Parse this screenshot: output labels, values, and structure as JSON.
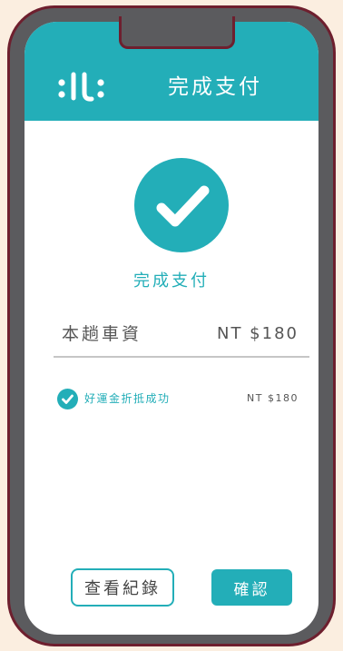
{
  "header": {
    "logo_icon": "brand-logo-icon",
    "title": "完成支付"
  },
  "result": {
    "icon": "check-circle-icon",
    "message": "完成支付"
  },
  "fare": {
    "label": "本趟車資",
    "amount": "NT $180"
  },
  "discount": {
    "icon": "check-circle-small-icon",
    "label": "好運金折抵成功",
    "amount": "NT $180"
  },
  "actions": {
    "history_label": "查看紀錄",
    "confirm_label": "確認"
  },
  "colors": {
    "accent": "#23aeb8",
    "background": "#fbeee0",
    "frame": "#5b5b5e",
    "frame_border": "#6e1f2e"
  }
}
